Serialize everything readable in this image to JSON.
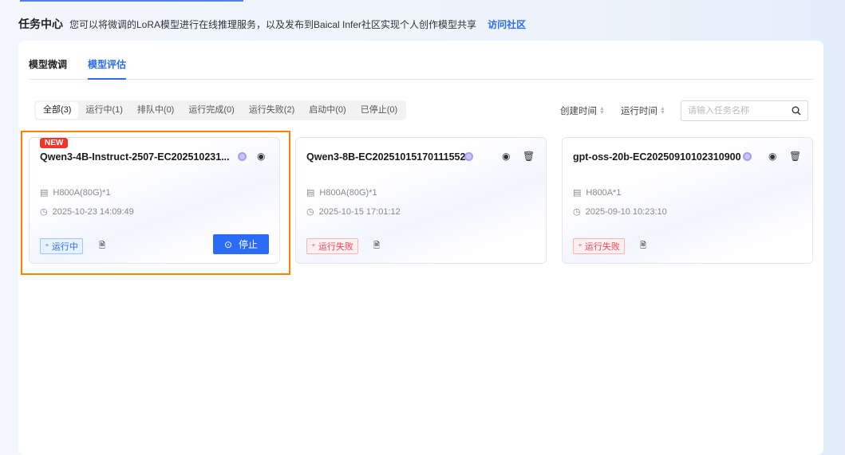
{
  "header": {
    "title": "任务中心",
    "description": "您可以将微调的LoRA模型进行在线推理服务，以及发布到Baical Infer社区实现个人创作模型共享",
    "link": "访问社区"
  },
  "tabs": [
    {
      "label": "模型微调",
      "active": false
    },
    {
      "label": "模型评估",
      "active": true
    }
  ],
  "filters": [
    "全部(3)",
    "运行中(1)",
    "排队中(0)",
    "运行完成(0)",
    "运行失败(2)",
    "启动中(0)",
    "已停止(0)"
  ],
  "sorts": [
    "创建时间",
    "运行时间"
  ],
  "search": {
    "placeholder": "请输入任务名称",
    "value": ""
  },
  "colors": {
    "accent": "#2b6cf6",
    "highlight": "#ff8000",
    "fail": "#f0455a"
  },
  "cards": [
    {
      "badge": "NEW",
      "title": "Qwen3-4B-Instruct-2507-EC202510231...",
      "gpu": "H800A(80G)*1",
      "time": "2025-10-23 14:09:49",
      "status": "运行中",
      "stop": "停止"
    },
    {
      "title": "Qwen3-8B-EC20251015170111552",
      "gpu": "H800A(80G)*1",
      "time": "2025-10-15 17:01:12",
      "status": "运行失败"
    },
    {
      "title": "gpt-oss-20b-EC20250910102310900",
      "gpu": "H800A*1",
      "time": "2025-09-10 10:23:10",
      "status": "运行失败"
    }
  ]
}
